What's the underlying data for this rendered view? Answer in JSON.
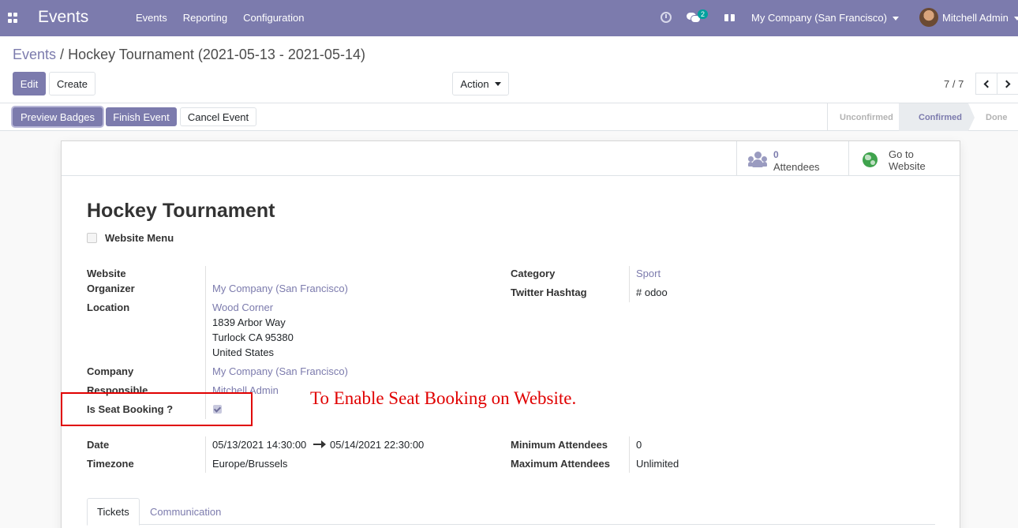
{
  "navbar": {
    "app_name": "Events",
    "menu": [
      "Events",
      "Reporting",
      "Configuration"
    ],
    "chat_badge": "2",
    "company": "My Company (San Francisco)",
    "user": "Mitchell Admin",
    "color": "#7c7bad"
  },
  "breadcrumb": {
    "parent": "Events",
    "separator": "/",
    "current": "Hockey Tournament (2021-05-13 - 2021-05-14)"
  },
  "buttons": {
    "edit": "Edit",
    "create": "Create",
    "action": "Action"
  },
  "pager": {
    "value": "7 / 7"
  },
  "header_buttons": {
    "preview_badges": "Preview Badges",
    "finish_event": "Finish Event",
    "cancel_event": "Cancel Event"
  },
  "status_steps": [
    "Unconfirmed",
    "Confirmed",
    "Done"
  ],
  "stat_buttons": {
    "attendees_value": "0",
    "attendees_label": "Attendees",
    "website_label_1": "Go to",
    "website_label_2": "Website"
  },
  "form": {
    "title": "Hockey Tournament",
    "website_menu_label": "Website Menu",
    "website_label": "Website",
    "organizer_label": "Organizer",
    "organizer_value": "My Company (San Francisco)",
    "location_label": "Location",
    "location_name": "Wood Corner",
    "location_line1": "1839 Arbor Way",
    "location_line2": "Turlock CA 95380",
    "location_line3": "United States",
    "company_label": "Company",
    "company_value": "My Company (San Francisco)",
    "responsible_label": "Responsible",
    "responsible_value": "Mitchell Admin",
    "seat_booking_label": "Is Seat Booking ?",
    "category_label": "Category",
    "category_value": "Sport",
    "hashtag_label": "Twitter Hashtag",
    "hashtag_value": "# odoo",
    "date_label": "Date",
    "date_start": "05/13/2021 14:30:00",
    "date_end": "05/14/2021 22:30:00",
    "timezone_label": "Timezone",
    "timezone_value": "Europe/Brussels",
    "min_attendees_label": "Minimum Attendees",
    "min_attendees_value": "0",
    "max_attendees_label": "Maximum Attendees",
    "max_attendees_value": "Unlimited"
  },
  "annotation": "To Enable Seat Booking on Website.",
  "tabs": [
    "Tickets",
    "Communication"
  ]
}
